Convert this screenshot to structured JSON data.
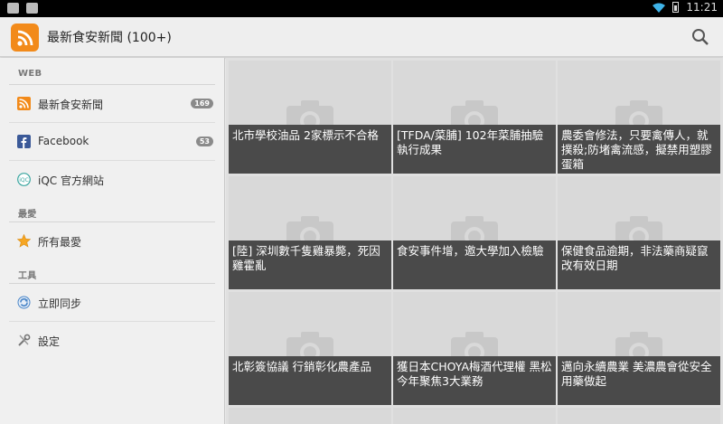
{
  "status_bar": {
    "time": "11:21"
  },
  "action_bar": {
    "title": "最新食安新聞 (100+)"
  },
  "drawer": {
    "sections": [
      {
        "header": "WEB"
      },
      {
        "header": "最愛"
      },
      {
        "header": "工具"
      }
    ],
    "items": [
      {
        "label": "最新食安新聞",
        "badge": "169",
        "icon": "rss-icon"
      },
      {
        "label": "Facebook",
        "badge": "53",
        "icon": "facebook-icon"
      },
      {
        "label": "iQC 官方網站",
        "badge": "",
        "icon": "iqc-icon"
      },
      {
        "label": "所有最愛",
        "badge": "",
        "icon": "star-icon"
      },
      {
        "label": "立即同步",
        "badge": "",
        "icon": "sync-icon"
      },
      {
        "label": "設定",
        "badge": "",
        "icon": "settings-icon"
      }
    ]
  },
  "articles": [
    {
      "title": "北市學校油品 2家標示不合格"
    },
    {
      "title": "[TFDA/菜脯] 102年菜脯抽驗執行成果"
    },
    {
      "title": "農委會修法，只要禽傳人，就撲殺;防堵禽流感，擬禁用塑膠蛋箱"
    },
    {
      "title": "[陸] 深圳數千隻雞暴斃，死因雞霍亂"
    },
    {
      "title": "食安事件增，邀大學加入檢驗"
    },
    {
      "title": "保健食品逾期，非法藥商疑竄改有效日期"
    },
    {
      "title": "北彰簽協議 行銷彰化農產品"
    },
    {
      "title": "獲日本CHOYA梅酒代理權 黑松今年聚焦3大業務"
    },
    {
      "title": "邁向永續農業 美濃農會從安全用藥做起"
    }
  ],
  "colors": {
    "accent": "#f28a1a",
    "caption_bg": "#4a4a4a"
  }
}
